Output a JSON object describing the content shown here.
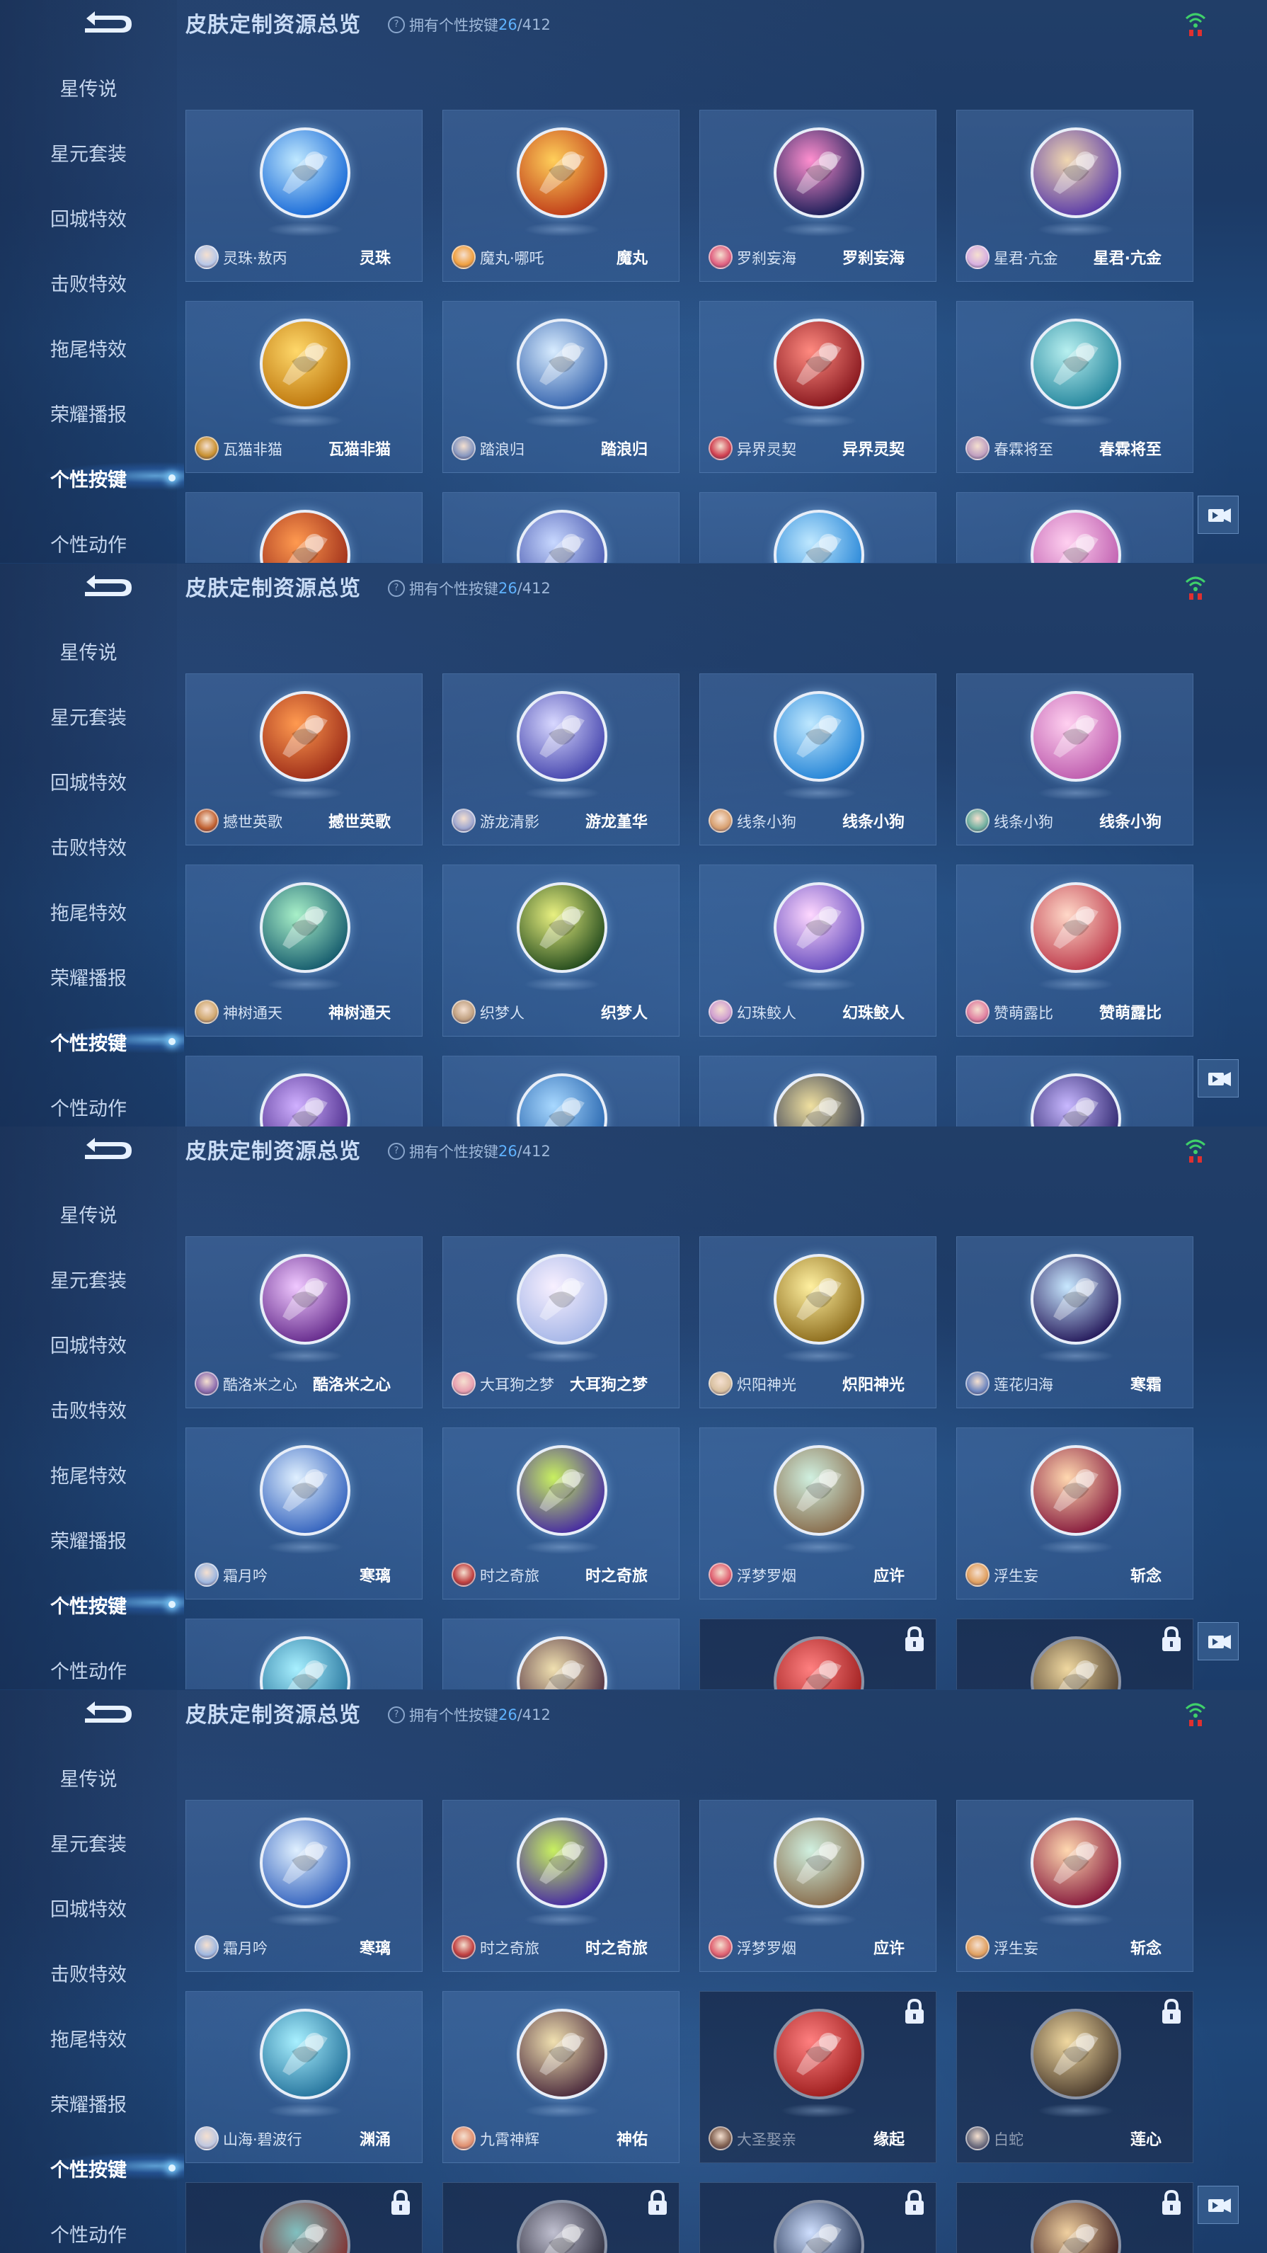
{
  "header": {
    "title": "皮肤定制资源总览",
    "owned_prefix": "拥有个性按键",
    "owned_count": "26",
    "owned_total": "/412"
  },
  "sidebar": [
    "星传说",
    "星元套装",
    "回城特效",
    "击败特效",
    "拖尾特效",
    "荣耀播报",
    "个性按键",
    "个性动作"
  ],
  "colors": {
    "accent": "#5fb2ff",
    "card": "#4a76a8",
    "text": "#c5d6ee"
  },
  "icons": [
    "back-arrow-icon",
    "wifi-icon",
    "help-icon",
    "lock-icon",
    "video-icon"
  ],
  "screens": [
    {
      "rows": [
        [
          {
            "hero": "灵珠·敖丙",
            "skin": "灵珠",
            "c1": "#bfe8ff",
            "c2": "#1e6ed8",
            "av": "#b8c8e8",
            "locked": false
          },
          {
            "hero": "魔丸·哪吒",
            "skin": "魔丸",
            "c1": "#ffcf5a",
            "c2": "#c1401a",
            "av": "#f0a040",
            "locked": false
          },
          {
            "hero": "罗刹妄海",
            "skin": "罗刹妄海",
            "c1": "#ff8fcf",
            "c2": "#20205a",
            "av": "#e06080",
            "locked": false
          },
          {
            "hero": "星君·亢金",
            "skin": "星君·亢金",
            "c1": "#f0d7b0",
            "c2": "#5d3ea8",
            "av": "#d8b0e0",
            "locked": false
          }
        ],
        [
          {
            "hero": "瓦猫非猫",
            "skin": "瓦猫非猫",
            "c1": "#ffd86a",
            "c2": "#c07a10",
            "av": "#c89030",
            "locked": false
          },
          {
            "hero": "踏浪归",
            "skin": "踏浪归",
            "c1": "#d8ecff",
            "c2": "#3a68b0",
            "av": "#8898c0",
            "locked": false
          },
          {
            "hero": "异界灵契",
            "skin": "异界灵契",
            "c1": "#ff8a80",
            "c2": "#8a1a20",
            "av": "#d04050",
            "locked": false
          },
          {
            "hero": "春霖将至",
            "skin": "春霖将至",
            "c1": "#b8f0f0",
            "c2": "#2a8aa0",
            "av": "#c0a0c0",
            "locked": false
          }
        ],
        [
          {
            "c1": "#ff9a50",
            "c2": "#a0301a",
            "locked": false
          },
          {
            "c1": "#c8d8ff",
            "c2": "#4a5ab0",
            "locked": false
          },
          {
            "c1": "#bfe8ff",
            "c2": "#2a88d8",
            "locked": false
          },
          {
            "c1": "#ffd0f0",
            "c2": "#c060b0",
            "locked": false
          }
        ]
      ]
    },
    {
      "rows": [
        [
          {
            "hero": "撼世英歌",
            "skin": "撼世英歌",
            "c1": "#ff9a50",
            "c2": "#a0301a",
            "av": "#c06030",
            "locked": false
          },
          {
            "hero": "游龙清影",
            "skin": "游龙堇华",
            "c1": "#d8d8ff",
            "c2": "#4a4ab0",
            "av": "#a0a8d0",
            "locked": false
          },
          {
            "hero": "线条小狗",
            "skin": "线条小狗",
            "c1": "#bfe8ff",
            "c2": "#2a88d8",
            "av": "#d8a070",
            "locked": false
          },
          {
            "hero": "线条小狗",
            "skin": "线条小狗",
            "c1": "#ffd0f0",
            "c2": "#c060b0",
            "av": "#70b0a0",
            "locked": false
          }
        ],
        [
          {
            "hero": "神树通天",
            "skin": "神树通天",
            "c1": "#a8f0c8",
            "c2": "#1a6070",
            "av": "#d0a870",
            "locked": false
          },
          {
            "hero": "织梦人",
            "skin": "织梦人",
            "c1": "#e8f080",
            "c2": "#2a5020",
            "av": "#c0a080",
            "locked": false
          },
          {
            "hero": "幻珠鲛人",
            "skin": "幻珠鲛人",
            "c1": "#ffd8ff",
            "c2": "#6a50c0",
            "av": "#d0a0d0",
            "locked": false
          },
          {
            "hero": "赞萌露比",
            "skin": "赞萌露比",
            "c1": "#ffd8c8",
            "c2": "#c04050",
            "av": "#e080a0",
            "locked": false
          }
        ],
        [
          {
            "c1": "#d0b0ff",
            "c2": "#503090",
            "locked": false
          },
          {
            "c1": "#a8d8ff",
            "c2": "#2a68b0",
            "locked": false
          },
          {
            "c1": "#f0e0a0",
            "c2": "#303850",
            "locked": false
          },
          {
            "c1": "#c8b8ff",
            "c2": "#302870",
            "locked": false
          }
        ]
      ]
    },
    {
      "rows": [
        [
          {
            "hero": "酷洛米之心",
            "skin": "酷洛米之心",
            "c1": "#f0c8ff",
            "c2": "#6a3090",
            "av": "#9070b0",
            "locked": false
          },
          {
            "hero": "大耳狗之梦",
            "skin": "大耳狗之梦",
            "c1": "#f8f0ff",
            "c2": "#a8b8e8",
            "av": "#e8a0b0",
            "locked": false
          },
          {
            "hero": "炽阳神光",
            "skin": "炽阳神光",
            "c1": "#fff0a0",
            "c2": "#907020",
            "av": "#d8c0a0",
            "locked": false
          },
          {
            "hero": "莲花归海",
            "skin": "寒霜",
            "c1": "#c8e8ff",
            "c2": "#2a2060",
            "av": "#7088c0",
            "locked": false
          }
        ],
        [
          {
            "hero": "霜月吟",
            "skin": "寒璃",
            "c1": "#e0f0ff",
            "c2": "#3a68c0",
            "av": "#a0b8e0",
            "locked": false
          },
          {
            "hero": "时之奇旅",
            "skin": "时之奇旅",
            "c1": "#c8f060",
            "c2": "#4a30a0",
            "av": "#c04040",
            "locked": false
          },
          {
            "hero": "浮梦罗烟",
            "skin": "应许",
            "c1": "#d0f0e0",
            "c2": "#8a7050",
            "av": "#e06070",
            "locked": false
          },
          {
            "hero": "浮生妄",
            "skin": "斩念",
            "c1": "#ffd8b0",
            "c2": "#8a2040",
            "av": "#e0a060",
            "locked": false
          }
        ],
        [
          {
            "c1": "#a8f0ff",
            "c2": "#2a78a0",
            "locked": false
          },
          {
            "c1": "#f0e0b0",
            "c2": "#503040",
            "locked": false
          },
          {
            "c1": "#ff8080",
            "c2": "#a02020",
            "locked": true
          },
          {
            "c1": "#f0d8a0",
            "c2": "#504030",
            "locked": true
          }
        ]
      ]
    },
    {
      "rows": [
        [
          {
            "hero": "霜月吟",
            "skin": "寒璃",
            "c1": "#e0f0ff",
            "c2": "#3a68c0",
            "av": "#a0b8e0",
            "locked": false
          },
          {
            "hero": "时之奇旅",
            "skin": "时之奇旅",
            "c1": "#c8f060",
            "c2": "#4a30a0",
            "av": "#c04040",
            "locked": false
          },
          {
            "hero": "浮梦罗烟",
            "skin": "应许",
            "c1": "#d0f0e0",
            "c2": "#8a7050",
            "av": "#e06070",
            "locked": false
          },
          {
            "hero": "浮生妄",
            "skin": "斩念",
            "c1": "#ffd8b0",
            "c2": "#8a2040",
            "av": "#e0a060",
            "locked": false
          }
        ],
        [
          {
            "hero": "山海·碧波行",
            "skin": "渊涌",
            "c1": "#a8f0ff",
            "c2": "#2a78a0",
            "av": "#c0c8e0",
            "locked": false
          },
          {
            "hero": "九霄神辉",
            "skin": "神佑",
            "c1": "#f0e0b0",
            "c2": "#503040",
            "av": "#e09070",
            "locked": false
          },
          {
            "hero": "大圣娶亲",
            "skin": "缘起",
            "c1": "#ff8080",
            "c2": "#a02020",
            "av": "#806050",
            "locked": true
          },
          {
            "hero": "白蛇",
            "skin": "莲心",
            "c1": "#f0d8a0",
            "c2": "#504030",
            "av": "#707080",
            "locked": true
          }
        ],
        [
          {
            "c1": "#80c0c0",
            "c2": "#803030",
            "locked": true
          },
          {
            "c1": "#c0c0d0",
            "c2": "#303040",
            "locked": true
          },
          {
            "c1": "#d0e0ff",
            "c2": "#203050",
            "locked": true
          },
          {
            "c1": "#f0d0a0",
            "c2": "#402020",
            "locked": true
          }
        ]
      ]
    }
  ]
}
